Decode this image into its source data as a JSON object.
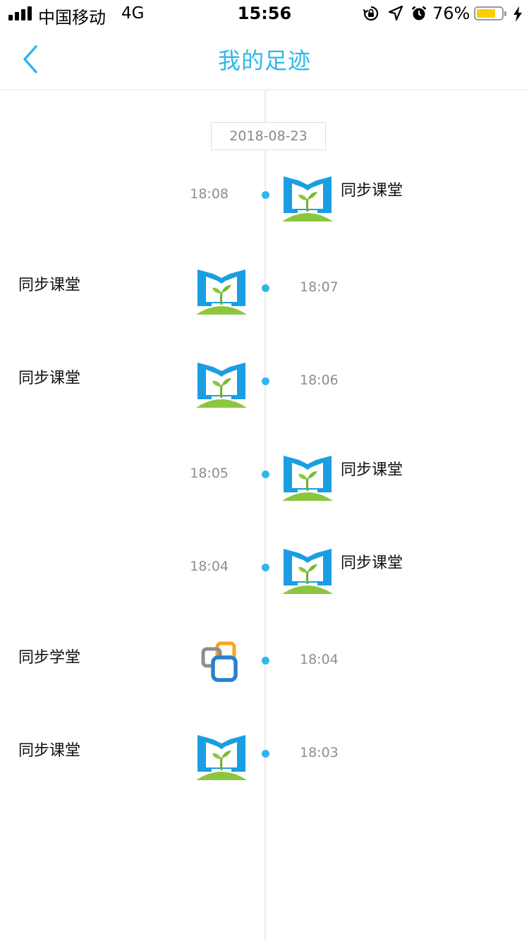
{
  "status_bar": {
    "carrier": "中国移动",
    "network": "4G",
    "time": "15:56",
    "battery_percent": "76%",
    "battery_level": 0.76,
    "icons": [
      "signal-icon",
      "orientation-lock-icon",
      "location-icon",
      "alarm-icon",
      "battery-icon",
      "charging-icon"
    ]
  },
  "nav": {
    "title": "我的足迹",
    "back_icon": "chevron-left-icon"
  },
  "timeline": {
    "date": "2018-08-23",
    "entries": [
      {
        "time": "18:08",
        "app": "同步课堂",
        "icon": "tongbu-ketang-icon",
        "side": "right"
      },
      {
        "time": "18:07",
        "app": "同步课堂",
        "icon": "tongbu-ketang-icon",
        "side": "left"
      },
      {
        "time": "18:06",
        "app": "同步课堂",
        "icon": "tongbu-ketang-icon",
        "side": "left"
      },
      {
        "time": "18:05",
        "app": "同步课堂",
        "icon": "tongbu-ketang-icon",
        "side": "right"
      },
      {
        "time": "18:04",
        "app": "同步课堂",
        "icon": "tongbu-ketang-icon",
        "side": "right"
      },
      {
        "time": "18:04",
        "app": "同步学堂",
        "icon": "tongbu-xuetang-icon",
        "side": "left"
      },
      {
        "time": "18:03",
        "app": "同步课堂",
        "icon": "tongbu-ketang-icon",
        "side": "left"
      }
    ]
  },
  "colors": {
    "accent": "#2fb7ea",
    "book_blue": "#1a9ee2",
    "sprout_green": "#8cc63f",
    "battery_yellow": "#ffcc00"
  }
}
